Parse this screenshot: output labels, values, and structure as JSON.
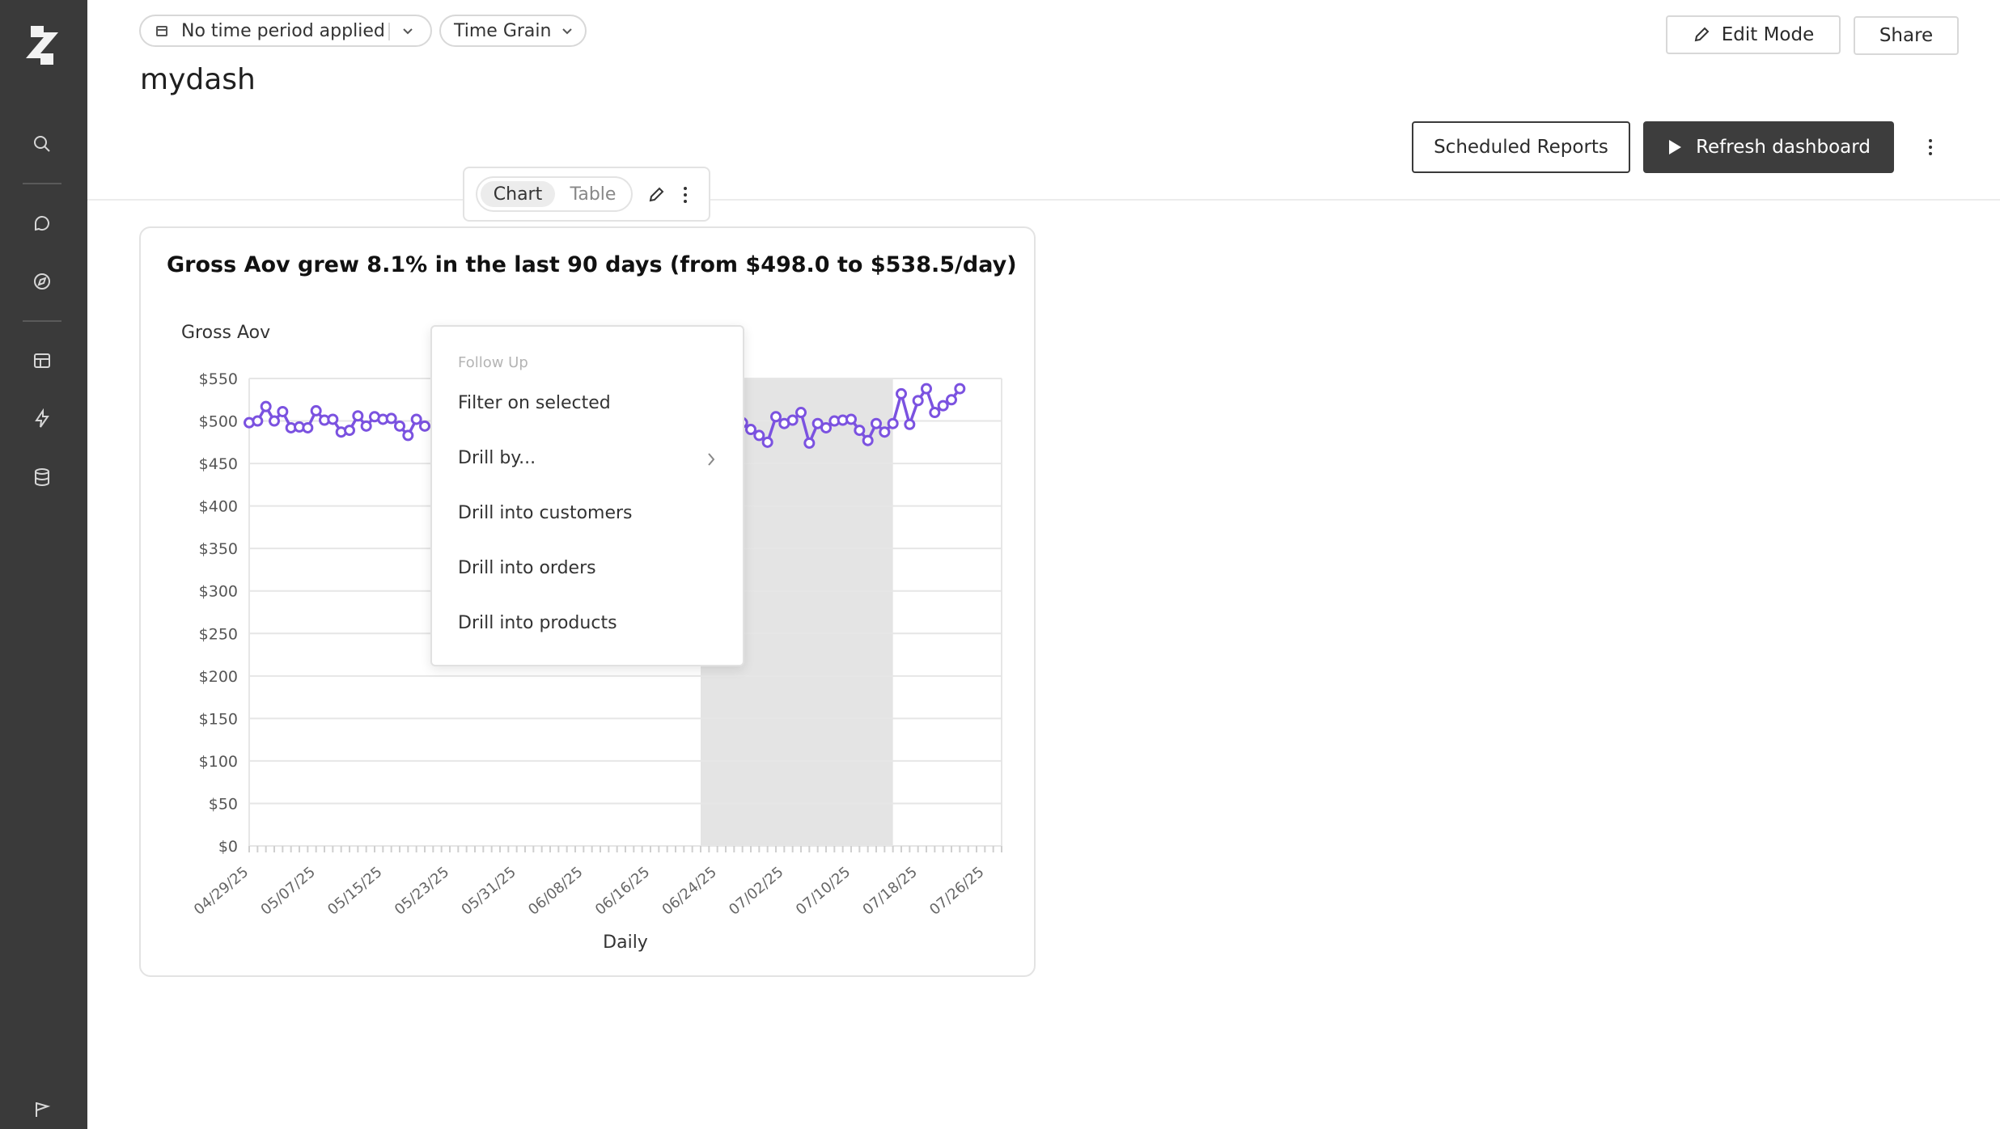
{
  "sidebar": {
    "icons": [
      "logo-icon",
      "search-icon",
      "chat-icon",
      "compass-icon",
      "layout-icon",
      "bolt-icon",
      "database-icon",
      "flag-icon"
    ]
  },
  "filters": {
    "time_period": "No time period applied",
    "time_grain": "Time Grain"
  },
  "page": {
    "title": "mydash"
  },
  "header": {
    "edit_mode": "Edit Mode",
    "share": "Share",
    "scheduled_reports": "Scheduled Reports",
    "refresh": "Refresh dashboard"
  },
  "toolbar": {
    "chart_tab": "Chart",
    "table_tab": "Table"
  },
  "card": {
    "title": "Gross Aov grew 8.1% in the last 90 days (from $498.0 to $538.5/day)"
  },
  "context_menu": {
    "header": "Follow Up",
    "items": [
      "Filter on selected",
      "Drill by...",
      "Drill into customers",
      "Drill into orders",
      "Drill into products"
    ]
  },
  "chart_data": {
    "type": "line",
    "ylabel": "Gross Aov",
    "xlabel": "Daily",
    "ylim": [
      0,
      550
    ],
    "y_ticks": [
      "$0",
      "$50",
      "$100",
      "$150",
      "$200",
      "$250",
      "$300",
      "$350",
      "$400",
      "$450",
      "$500",
      "$550"
    ],
    "x_ticks": [
      "04/29/25",
      "05/07/25",
      "05/15/25",
      "05/23/25",
      "05/31/25",
      "06/08/25",
      "06/16/25",
      "06/24/25",
      "07/02/25",
      "07/10/25",
      "07/18/25",
      "07/26/25"
    ],
    "x_start": "2025-04-29",
    "x_end": "2025-07-28",
    "highlight_range": [
      "06/22/25",
      "07/15/25"
    ],
    "series": [
      {
        "color": "#7b52e0",
        "points": [
          [
            "2025-04-29",
            498
          ],
          [
            "2025-04-30",
            500
          ],
          [
            "2025-05-01",
            517
          ],
          [
            "2025-05-02",
            500
          ],
          [
            "2025-05-03",
            511
          ],
          [
            "2025-05-04",
            492
          ],
          [
            "2025-05-05",
            493
          ],
          [
            "2025-05-06",
            492
          ],
          [
            "2025-05-07",
            512
          ],
          [
            "2025-05-08",
            501
          ],
          [
            "2025-05-09",
            502
          ],
          [
            "2025-05-10",
            487
          ],
          [
            "2025-05-11",
            489
          ],
          [
            "2025-05-12",
            506
          ],
          [
            "2025-05-13",
            494
          ],
          [
            "2025-05-14",
            505
          ],
          [
            "2025-05-15",
            502
          ],
          [
            "2025-05-16",
            503
          ],
          [
            "2025-05-17",
            494
          ],
          [
            "2025-05-18",
            483
          ],
          [
            "2025-05-19",
            502
          ],
          [
            "2025-05-20",
            494
          ],
          [
            "2025-06-24",
            490
          ],
          [
            "2025-06-25",
            502
          ],
          [
            "2025-06-26",
            494
          ],
          [
            "2025-06-27",
            498
          ],
          [
            "2025-06-28",
            490
          ],
          [
            "2025-06-29",
            483
          ],
          [
            "2025-06-30",
            475
          ],
          [
            "2025-07-01",
            505
          ],
          [
            "2025-07-02",
            497
          ],
          [
            "2025-07-03",
            501
          ],
          [
            "2025-07-04",
            510
          ],
          [
            "2025-07-05",
            474
          ],
          [
            "2025-07-06",
            497
          ],
          [
            "2025-07-07",
            492
          ],
          [
            "2025-07-08",
            500
          ],
          [
            "2025-07-09",
            501
          ],
          [
            "2025-07-10",
            502
          ],
          [
            "2025-07-11",
            489
          ],
          [
            "2025-07-12",
            477
          ],
          [
            "2025-07-13",
            497
          ],
          [
            "2025-07-14",
            487
          ],
          [
            "2025-07-15",
            497
          ],
          [
            "2025-07-16",
            532
          ],
          [
            "2025-07-17",
            496
          ],
          [
            "2025-07-18",
            524
          ],
          [
            "2025-07-19",
            538
          ],
          [
            "2025-07-20",
            510
          ],
          [
            "2025-07-21",
            518
          ],
          [
            "2025-07-22",
            525
          ],
          [
            "2025-07-23",
            538
          ]
        ]
      }
    ]
  }
}
